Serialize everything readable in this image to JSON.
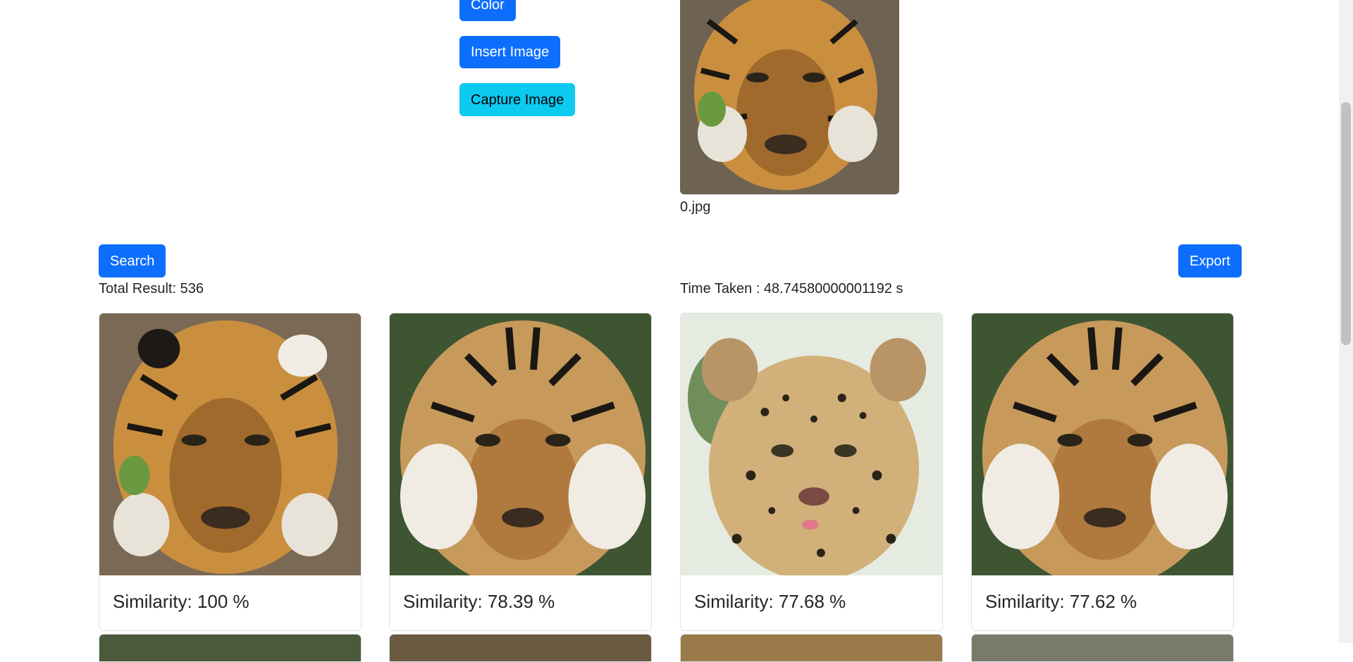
{
  "buttons": {
    "color": "Color",
    "insert_image": "Insert Image",
    "capture_image": "Capture Image",
    "search": "Search",
    "export": "Export"
  },
  "query": {
    "filename": "0.jpg"
  },
  "summary": {
    "total_result": "Total Result: 536",
    "time_taken": "Time Taken : 48.74580000001192 s"
  },
  "results": [
    {
      "similarity": "Similarity: 100 %"
    },
    {
      "similarity": "Similarity: 78.39 %"
    },
    {
      "similarity": "Similarity: 77.68 %"
    },
    {
      "similarity": "Similarity: 77.62 %"
    }
  ],
  "colors": {
    "primary": "#0d6efd",
    "info": "#0dcaf0",
    "border": "#dee2e6"
  }
}
